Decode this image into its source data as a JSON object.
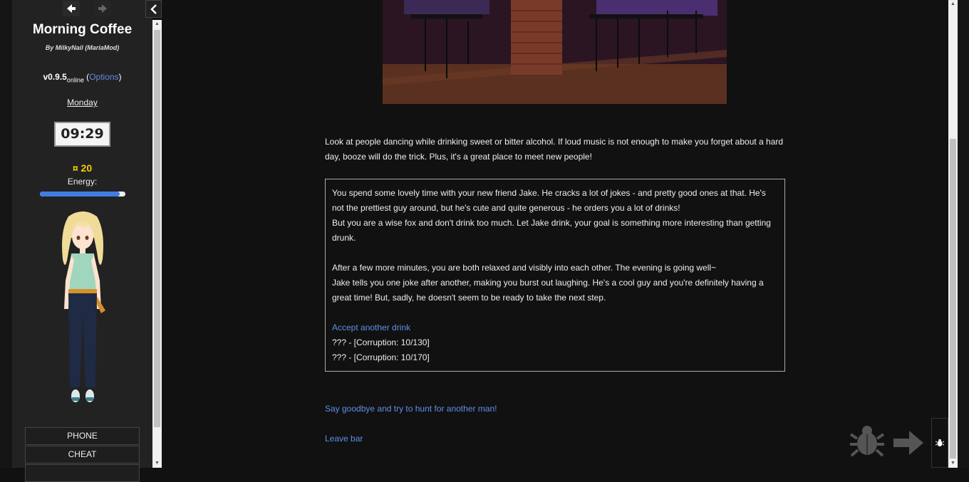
{
  "sidebar": {
    "title": "Morning Coffee",
    "byline": "By MilkyNail (MariaMod)",
    "version": "v0.9.5",
    "version_suffix": "online",
    "options_label": "Options",
    "day": "Monday",
    "time": "09:29",
    "money_icon": "¤",
    "money": "20",
    "energy_label": "Energy:",
    "energy_fraction": 0.93,
    "menu": [
      {
        "label": "PHONE"
      },
      {
        "label": "CHEAT"
      }
    ]
  },
  "main": {
    "intro": "Look at people dancing while drinking sweet or bitter alcohol. If loud music is not enough to make you forget about a hard day, booze will do the trick. Plus, it's a great place to meet new people!",
    "box": {
      "p1": "You spend some lovely time with your new friend Jake. He cracks a lot of jokes - and pretty good ones at that. He's not the prettiest guy around, but he's cute and quite generous - he orders you a lot of drinks!",
      "p2": "But you are a wise fox and don't drink too much. Let Jake drink, your goal is something more interesting than getting drunk.",
      "p3": "After a few more minutes, you are both relaxed and visibly into each other. The evening is going well~",
      "p4": "Jake tells you one joke after another, making you burst out laughing. He's a cool guy and you're definitely having a great time! But, sadly, he doesn't seem to be ready to take the next step.",
      "link": "Accept another drink",
      "locked1": "??? - [Corruption: 10/130]",
      "locked2": "??? - [Corruption: 10/170]"
    },
    "choice_goodbye": "Say goodbye and try to hunt for another man!",
    "choice_leave": "Leave bar"
  },
  "colors": {
    "link": "#5f8fe6",
    "money": "#f0d000",
    "energy": "#3f7ee0",
    "background": "#111111",
    "sidebar": "#222222"
  },
  "icons": {
    "back": "arrow-left-icon",
    "forward": "arrow-right-icon",
    "collapse": "chevron-left-icon",
    "debug": "bug-icon"
  }
}
